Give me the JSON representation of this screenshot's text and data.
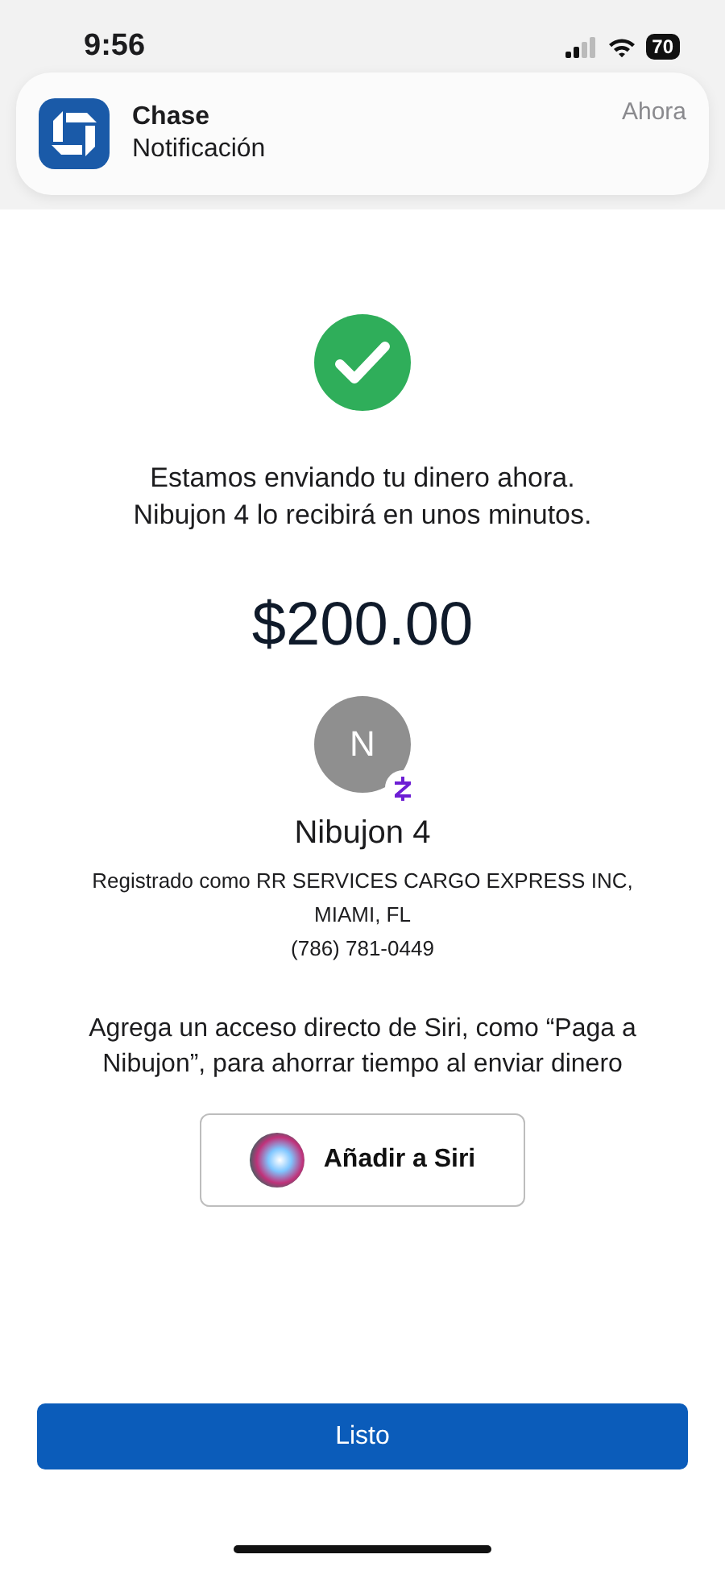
{
  "status_bar": {
    "time": "9:56",
    "battery": "70"
  },
  "notification": {
    "app": "Chase",
    "message": "Notificación",
    "time": "Ahora"
  },
  "confirmation": {
    "message_lines": [
      "Estamos enviando tu dinero ahora.",
      "Nibujon 4 lo recibirá en unos minutos."
    ],
    "amount": "$200.00"
  },
  "recipient": {
    "initial": "N",
    "name": "Nibujon 4",
    "details": [
      "Registrado como RR SERVICES CARGO EXPRESS INC,",
      "MIAMI, FL",
      "(786) 781-0449"
    ]
  },
  "siri": {
    "text": "Agrega un acceso directo de Siri, como “Paga a Nibujon”, para ahorrar tiempo al enviar dinero",
    "button": "Añadir a Siri"
  },
  "done_button": "Listo"
}
